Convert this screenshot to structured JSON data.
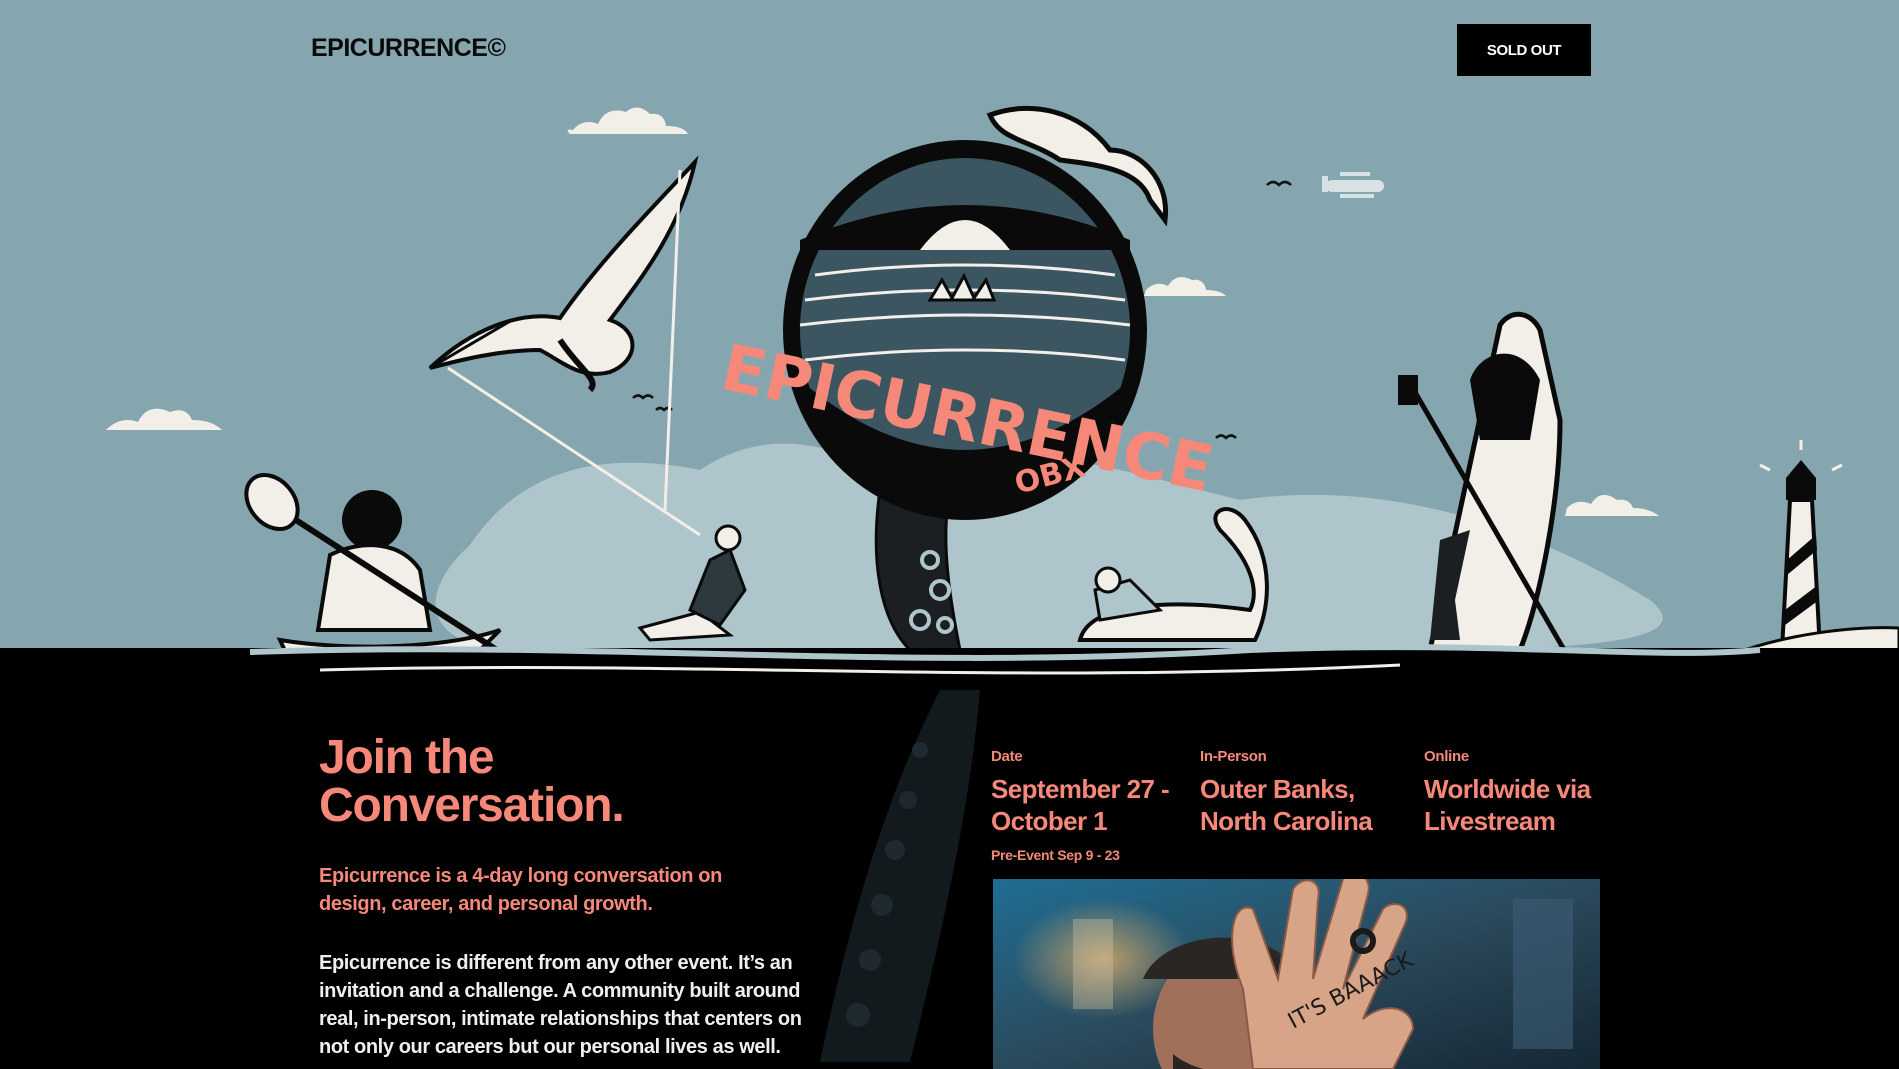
{
  "header": {
    "logo": "EPICURRENCE©",
    "cta_label": "SOLD OUT"
  },
  "hero": {
    "badge_text": "EPICURRENCE",
    "badge_subtext": "OBX",
    "palette": {
      "sky": "#86a6af",
      "ground": "#000000",
      "accent": "#f6887a",
      "cloud": "#f2efe9",
      "water": "#aec5cb"
    }
  },
  "main": {
    "headline_line1": "Join the",
    "headline_line2": "Conversation.",
    "lede": "Epicurrence is a 4-day long conversation on design, career, and personal growth.",
    "body": "Epicurrence is different from any other event. It’s an invitation and a challenge. A community built around real, in-person, intimate relationships that centers on not only our careers but our personal lives as well."
  },
  "event_info": {
    "date": {
      "label": "Date",
      "value_line1": "September 27 -",
      "value_line2": "October 1",
      "sub": "Pre-Event Sep 9 - 23"
    },
    "in_person": {
      "label": "In-Person",
      "value_line1": "Outer Banks,",
      "value_line2": "North Carolina"
    },
    "online": {
      "label": "Online",
      "value_line1": "Worldwide via",
      "value_line2": "Livestream"
    }
  },
  "video": {
    "hand_text": "IT'S BAAACK"
  }
}
